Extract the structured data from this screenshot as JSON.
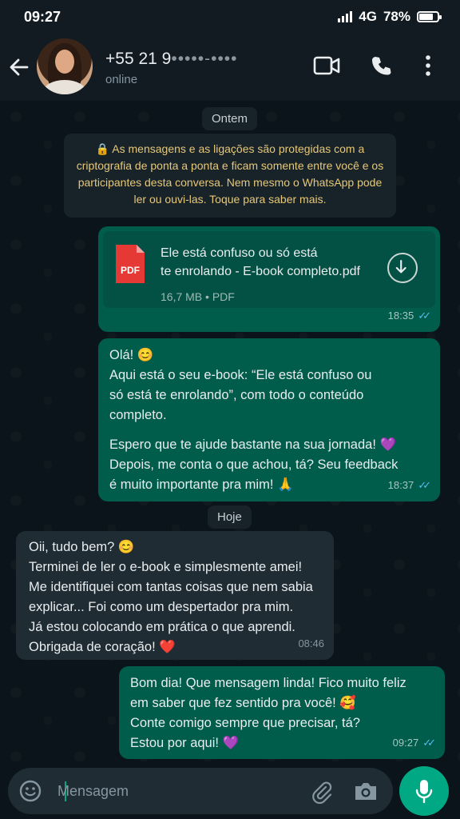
{
  "status_bar": {
    "time": "09:27",
    "network": "4G",
    "battery": "78%",
    "battery_level": 0.78
  },
  "header": {
    "contact_name_visible": "+55 21 9",
    "contact_name_masked": "•••••-••••",
    "contact_status": "online",
    "icons": [
      "back-arrow-icon",
      "video-call-icon",
      "voice-call-icon",
      "more-options-icon"
    ]
  },
  "chat": {
    "day_yesterday": "Ontem",
    "encryption_notice": "🔒 As mensagens e as ligações são protegidas com a criptografia de ponta a ponta e ficam somente entre você e os participantes desta conversa. Nem mesmo o WhatsApp pode ler ou ouvi-las. Toque para saber mais.",
    "document": {
      "title_line1": "Ele está confuso ou só está",
      "title_line2": "te enrolando - E-book completo.pdf",
      "info": "16,7 MB • PDF",
      "icon_label": "PDF",
      "time": "18:35"
    },
    "msg1": {
      "lines": [
        "Olá! 😊",
        "Aqui está o seu e-book: “Ele está confuso ou",
        "só está te enrolando”, com todo o conteúdo",
        "completo.",
        "Espero que te ajude bastante na sua jornada! 💜",
        "Depois, me conta o que achou, tá? Seu feedback",
        "é muito importante pra mim! 🙏"
      ],
      "time": "18:37"
    },
    "day_today": "Hoje",
    "msg2": {
      "lines": [
        "Oii, tudo bem? 😊",
        "Terminei de ler o e-book e simplesmente amei!",
        "Me identifiquei com tantas coisas que nem sabia",
        "explicar... Foi como um despertador pra mim.",
        "Já estou colocando em prática o que aprendi.",
        "Obrigada de coração! ❤️"
      ],
      "time": "08:46"
    },
    "msg3": {
      "lines": [
        "Bom dia!  Que mensagem linda! Fico muito feliz",
        "em saber que fez sentido pra você! 🥰",
        "Conte comigo sempre que precisar, tá?",
        "Estou por aqui! 💜"
      ],
      "time": "09:27"
    }
  },
  "input": {
    "placeholder": "Mensagem"
  },
  "colors": {
    "accent": "#00a884",
    "outgoing": "#005c4b",
    "incoming": "#1f2c34",
    "read_ticks": "#53bdeb"
  }
}
